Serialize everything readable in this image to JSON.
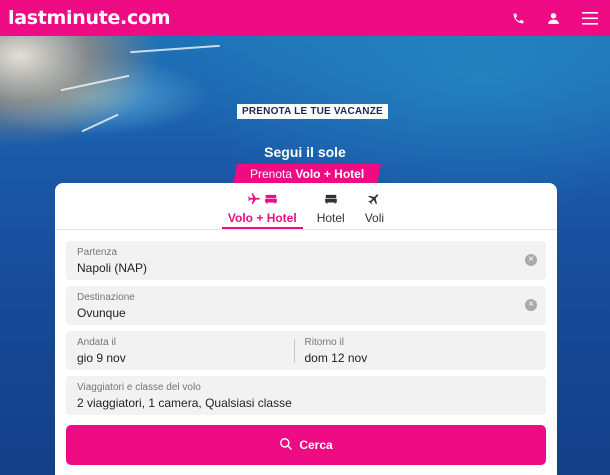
{
  "header": {
    "logo": "lastminute.com"
  },
  "hero": {
    "tag": "PRENOTA LE TUE VACANZE",
    "title": "Segui il sole",
    "promo_prefix": "Prenota",
    "promo_highlight": "Volo + Hotel"
  },
  "tabs": [
    {
      "label": "Volo + Hotel",
      "active": true
    },
    {
      "label": "Hotel",
      "active": false
    },
    {
      "label": "Voli",
      "active": false
    }
  ],
  "form": {
    "departure": {
      "label": "Partenza",
      "value": "Napoli (NAP)"
    },
    "destination": {
      "label": "Destinazione",
      "value": "Ovunque"
    },
    "outbound": {
      "label": "Andata il",
      "value": "gio 9 nov"
    },
    "return": {
      "label": "Ritorno il",
      "value": "dom 12 nov"
    },
    "travellers": {
      "label": "Viaggiatori e classe del volo",
      "value": "2 viaggiatori, 1 camera, Qualsiasi classe"
    },
    "search_label": "Cerca"
  },
  "colors": {
    "brand": "#ee0b84",
    "field_bg": "#f2f2f2"
  }
}
